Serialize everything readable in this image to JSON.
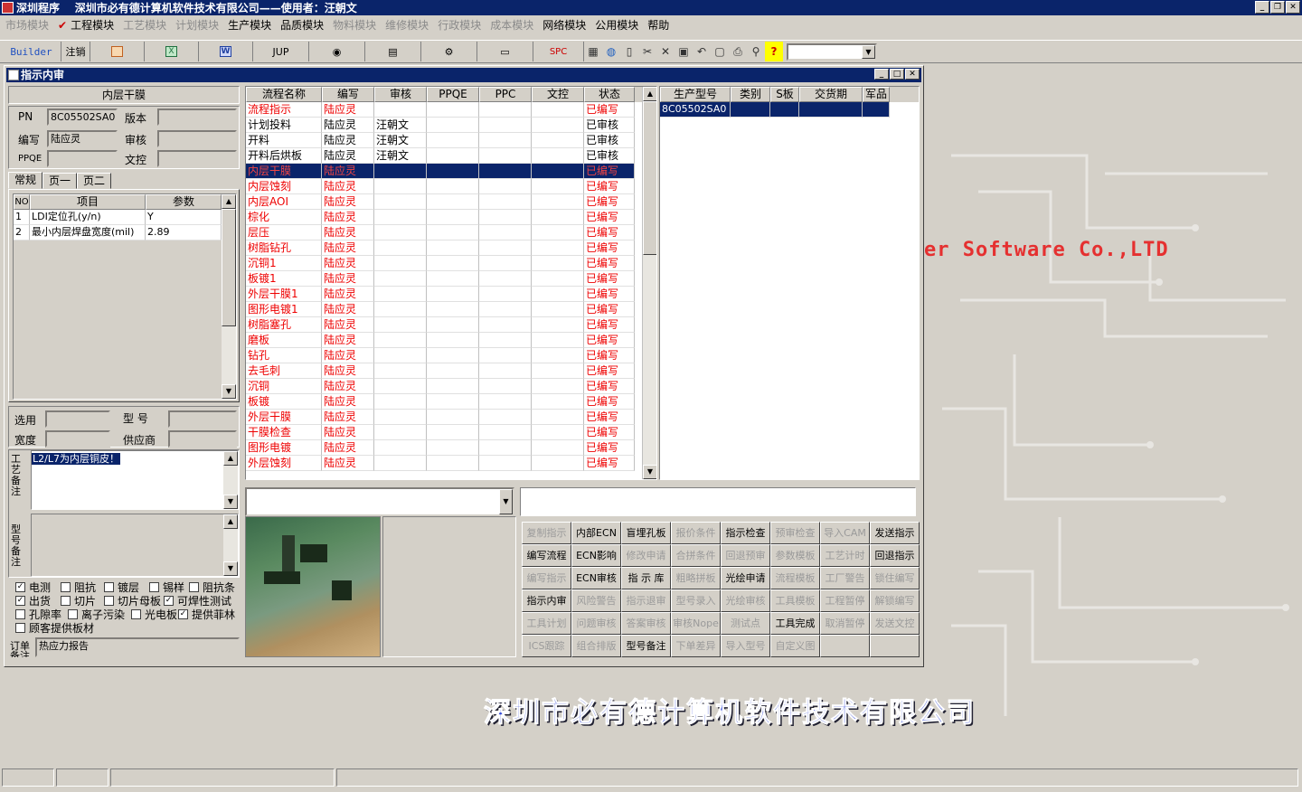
{
  "app": {
    "title": "深圳程序    深圳市必有德计算机软件技术有限公司——使用者：汪朝文"
  },
  "menu": [
    {
      "label": "市场模块",
      "enabled": false
    },
    {
      "label": "工程模块",
      "enabled": true,
      "checked": true
    },
    {
      "label": "工艺模块",
      "enabled": false
    },
    {
      "label": "计划模块",
      "enabled": false
    },
    {
      "label": "生产模块",
      "enabled": true
    },
    {
      "label": "品质模块",
      "enabled": true
    },
    {
      "label": "物料模块",
      "enabled": false
    },
    {
      "label": "维修模块",
      "enabled": false
    },
    {
      "label": "行政模块",
      "enabled": false
    },
    {
      "label": "成本模块",
      "enabled": false
    },
    {
      "label": "网络模块",
      "enabled": true
    },
    {
      "label": "公用模块",
      "enabled": true
    },
    {
      "label": "帮助",
      "enabled": true
    }
  ],
  "toolbar": {
    "builder": "Builder",
    "logout": "注销",
    "jup": "JUP",
    "spc": "SPC"
  },
  "window": {
    "title": "指示内审"
  },
  "left": {
    "section_title": "内层干膜",
    "pn_label": "PN",
    "pn_value": "8C05502SA0",
    "version_label": "版本",
    "version_value": "",
    "writer_label": "编写",
    "writer_value": "陆应灵",
    "audit_label": "审核",
    "audit_value": "",
    "ppqe_label": "PPQE",
    "ppqe_value": "",
    "doc_label": "文控",
    "doc_value": "",
    "tabs": [
      "常规",
      "页一",
      "页二"
    ],
    "param_headers": [
      "NO",
      "项目",
      "参数"
    ],
    "params": [
      {
        "no": "1",
        "item": "LDI定位孔(y/n)",
        "value": "Y"
      },
      {
        "no": "2",
        "item": "最小内层焊盘宽度(mil)",
        "value": "2.89"
      }
    ],
    "select_label": "选用",
    "model_label": "型  号",
    "width_label": "宽度",
    "supplier_label": "供应商",
    "craft_note_label": "工艺备注",
    "craft_note_value": "L2/L7为内层铜皮！",
    "model_note_label": "型号备注",
    "checkboxes": [
      {
        "label": "电测",
        "checked": true
      },
      {
        "label": "阻抗",
        "checked": false
      },
      {
        "label": "镀层",
        "checked": false
      },
      {
        "label": "锡样",
        "checked": false
      },
      {
        "label": "阻抗条",
        "checked": false
      },
      {
        "label": "出货",
        "checked": true
      },
      {
        "label": "切片",
        "checked": false
      },
      {
        "label": "切片母板",
        "checked": false
      },
      {
        "label": "可焊性测试",
        "checked": true
      },
      {
        "label": "孔隙率",
        "checked": false
      },
      {
        "label": "离子污染",
        "checked": false
      },
      {
        "label": "光电板",
        "checked": false
      },
      {
        "label": "提供菲林",
        "checked": true
      },
      {
        "label": "顾客提供板材",
        "checked": false
      }
    ],
    "order_note_label": "订单备注",
    "order_note_value": "热应力报告"
  },
  "process_grid": {
    "headers": [
      "流程名称",
      "编写",
      "审核",
      "PPQE",
      "PPC",
      "文控",
      "状态"
    ],
    "rows": [
      {
        "name": "流程指示",
        "writer": "陆应灵",
        "audit": "",
        "ppqe": "",
        "ppc": "",
        "doc": "",
        "status": "已编写",
        "style": "red"
      },
      {
        "name": "计划投料",
        "writer": "陆应灵",
        "audit": "汪朝文",
        "ppqe": "",
        "ppc": "",
        "doc": "",
        "status": "已审核",
        "style": "black"
      },
      {
        "name": "开料",
        "writer": "陆应灵",
        "audit": "汪朝文",
        "ppqe": "",
        "ppc": "",
        "doc": "",
        "status": "已审核",
        "style": "black"
      },
      {
        "name": "开料后烘板",
        "writer": "陆应灵",
        "audit": "汪朝文",
        "ppqe": "",
        "ppc": "",
        "doc": "",
        "status": "已审核",
        "style": "black"
      },
      {
        "name": "内层干膜",
        "writer": "陆应灵",
        "audit": "",
        "ppqe": "",
        "ppc": "",
        "doc": "",
        "status": "已编写",
        "style": "sel"
      },
      {
        "name": "内层蚀刻",
        "writer": "陆应灵",
        "audit": "",
        "ppqe": "",
        "ppc": "",
        "doc": "",
        "status": "已编写",
        "style": "red"
      },
      {
        "name": "内层AOI",
        "writer": "陆应灵",
        "audit": "",
        "ppqe": "",
        "ppc": "",
        "doc": "",
        "status": "已编写",
        "style": "red"
      },
      {
        "name": "棕化",
        "writer": "陆应灵",
        "audit": "",
        "ppqe": "",
        "ppc": "",
        "doc": "",
        "status": "已编写",
        "style": "red"
      },
      {
        "name": "层压",
        "writer": "陆应灵",
        "audit": "",
        "ppqe": "",
        "ppc": "",
        "doc": "",
        "status": "已编写",
        "style": "red"
      },
      {
        "name": "树脂钻孔",
        "writer": "陆应灵",
        "audit": "",
        "ppqe": "",
        "ppc": "",
        "doc": "",
        "status": "已编写",
        "style": "red"
      },
      {
        "name": "沉铜1",
        "writer": "陆应灵",
        "audit": "",
        "ppqe": "",
        "ppc": "",
        "doc": "",
        "status": "已编写",
        "style": "red"
      },
      {
        "name": "板镀1",
        "writer": "陆应灵",
        "audit": "",
        "ppqe": "",
        "ppc": "",
        "doc": "",
        "status": "已编写",
        "style": "red"
      },
      {
        "name": "外层干膜1",
        "writer": "陆应灵",
        "audit": "",
        "ppqe": "",
        "ppc": "",
        "doc": "",
        "status": "已编写",
        "style": "red"
      },
      {
        "name": "图形电镀1",
        "writer": "陆应灵",
        "audit": "",
        "ppqe": "",
        "ppc": "",
        "doc": "",
        "status": "已编写",
        "style": "red"
      },
      {
        "name": "树脂塞孔",
        "writer": "陆应灵",
        "audit": "",
        "ppqe": "",
        "ppc": "",
        "doc": "",
        "status": "已编写",
        "style": "red"
      },
      {
        "name": "磨板",
        "writer": "陆应灵",
        "audit": "",
        "ppqe": "",
        "ppc": "",
        "doc": "",
        "status": "已编写",
        "style": "red"
      },
      {
        "name": "钻孔",
        "writer": "陆应灵",
        "audit": "",
        "ppqe": "",
        "ppc": "",
        "doc": "",
        "status": "已编写",
        "style": "red"
      },
      {
        "name": "去毛刺",
        "writer": "陆应灵",
        "audit": "",
        "ppqe": "",
        "ppc": "",
        "doc": "",
        "status": "已编写",
        "style": "red"
      },
      {
        "name": "沉铜",
        "writer": "陆应灵",
        "audit": "",
        "ppqe": "",
        "ppc": "",
        "doc": "",
        "status": "已编写",
        "style": "red"
      },
      {
        "name": "板镀",
        "writer": "陆应灵",
        "audit": "",
        "ppqe": "",
        "ppc": "",
        "doc": "",
        "status": "已编写",
        "style": "red"
      },
      {
        "name": "外层干膜",
        "writer": "陆应灵",
        "audit": "",
        "ppqe": "",
        "ppc": "",
        "doc": "",
        "status": "已编写",
        "style": "red"
      },
      {
        "name": "干膜检查",
        "writer": "陆应灵",
        "audit": "",
        "ppqe": "",
        "ppc": "",
        "doc": "",
        "status": "已编写",
        "style": "red"
      },
      {
        "name": "图形电镀",
        "writer": "陆应灵",
        "audit": "",
        "ppqe": "",
        "ppc": "",
        "doc": "",
        "status": "已编写",
        "style": "red"
      },
      {
        "name": "外层蚀刻",
        "writer": "陆应灵",
        "audit": "",
        "ppqe": "",
        "ppc": "",
        "doc": "",
        "status": "已编写",
        "style": "red"
      }
    ]
  },
  "model_grid": {
    "headers": [
      "生产型号",
      "类别",
      "S板",
      "交货期",
      "军品"
    ],
    "rows": [
      {
        "model": "8C05502SA0",
        "type": "",
        "s": "",
        "due": "",
        "mil": ""
      }
    ]
  },
  "buttons": [
    {
      "label": "复制指示",
      "enabled": false
    },
    {
      "label": "内部ECN",
      "enabled": true
    },
    {
      "label": "盲埋孔板",
      "enabled": true
    },
    {
      "label": "报价条件",
      "enabled": false
    },
    {
      "label": "指示检查",
      "enabled": true
    },
    {
      "label": "预审检查",
      "enabled": false
    },
    {
      "label": "导入CAM",
      "enabled": false
    },
    {
      "label": "发送指示",
      "enabled": true
    },
    {
      "label": "编写流程",
      "enabled": true
    },
    {
      "label": "ECN影响",
      "enabled": true
    },
    {
      "label": "修改申请",
      "enabled": false
    },
    {
      "label": "合拼条件",
      "enabled": false
    },
    {
      "label": "回退预审",
      "enabled": false
    },
    {
      "label": "参数模板",
      "enabled": false
    },
    {
      "label": "工艺计时",
      "enabled": false
    },
    {
      "label": "回退指示",
      "enabled": true
    },
    {
      "label": "编写指示",
      "enabled": false
    },
    {
      "label": "ECN审核",
      "enabled": true
    },
    {
      "label": "指 示 库",
      "enabled": true
    },
    {
      "label": "粗略拼板",
      "enabled": false
    },
    {
      "label": "光绘申请",
      "enabled": true
    },
    {
      "label": "流程模板",
      "enabled": false
    },
    {
      "label": "工厂警告",
      "enabled": false
    },
    {
      "label": "锁住编写",
      "enabled": false
    },
    {
      "label": "指示内审",
      "enabled": true
    },
    {
      "label": "风险警告",
      "enabled": false
    },
    {
      "label": "指示退审",
      "enabled": false
    },
    {
      "label": "型号录入",
      "enabled": false
    },
    {
      "label": "光绘审核",
      "enabled": false
    },
    {
      "label": "工具模板",
      "enabled": false
    },
    {
      "label": "工程暂停",
      "enabled": false
    },
    {
      "label": "解锁编写",
      "enabled": false
    },
    {
      "label": "工具计划",
      "enabled": false
    },
    {
      "label": "问题审核",
      "enabled": false
    },
    {
      "label": "答案审核",
      "enabled": false
    },
    {
      "label": "审核Nope",
      "enabled": false
    },
    {
      "label": "测试点",
      "enabled": false
    },
    {
      "label": "工具完成",
      "enabled": true
    },
    {
      "label": "取消暂停",
      "enabled": false
    },
    {
      "label": "发送文控",
      "enabled": false
    },
    {
      "label": "ICS跟踪",
      "enabled": false
    },
    {
      "label": "组合排版",
      "enabled": false
    },
    {
      "label": "型号备注",
      "enabled": true
    },
    {
      "label": "下单差异",
      "enabled": false
    },
    {
      "label": "导入型号",
      "enabled": false
    },
    {
      "label": "自定义图",
      "enabled": false
    },
    {
      "label": "",
      "enabled": false
    },
    {
      "label": "",
      "enabled": false
    }
  ],
  "background": {
    "company_en": "er Software Co.,LTD",
    "company_cn": "深圳市必有德计算机软件技术有限公司"
  }
}
